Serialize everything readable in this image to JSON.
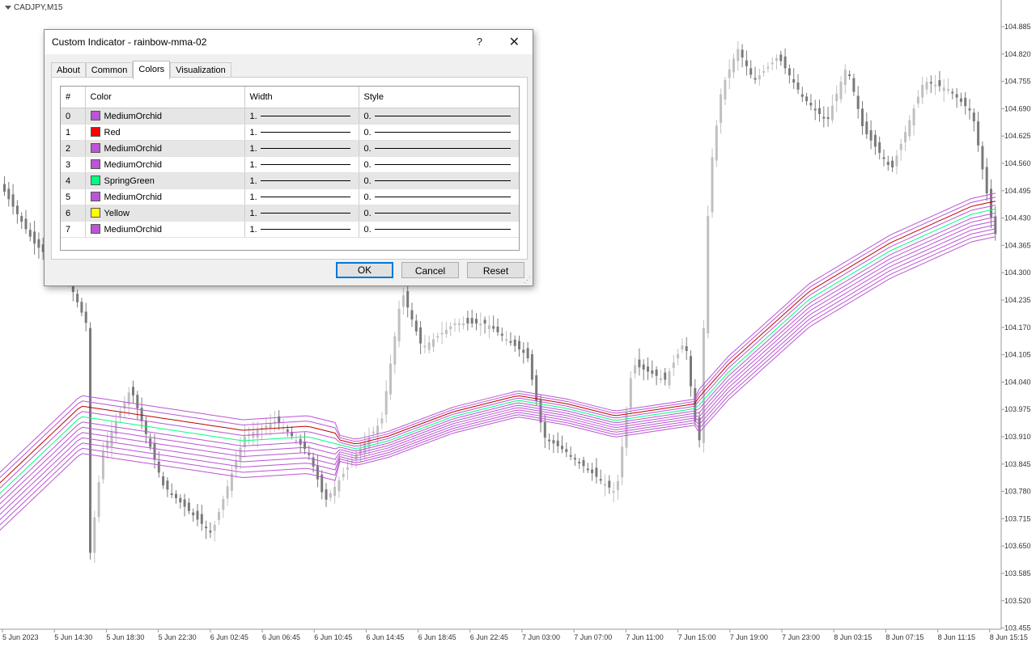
{
  "chart": {
    "symbol": "CADJPY,M15",
    "price_labels": [
      "104.885",
      "104.820",
      "104.755",
      "104.690",
      "104.625",
      "104.560",
      "104.495",
      "104.430",
      "104.365",
      "104.300",
      "104.235",
      "104.170",
      "104.105",
      "104.040",
      "103.975",
      "103.910",
      "103.845",
      "103.780",
      "103.715",
      "103.650",
      "103.585",
      "103.520",
      "103.455"
    ],
    "time_labels": [
      "5 Jun 2023",
      "5 Jun 14:30",
      "5 Jun 18:30",
      "5 Jun 22:30",
      "6 Jun 02:45",
      "6 Jun 06:45",
      "6 Jun 10:45",
      "6 Jun 14:45",
      "6 Jun 18:45",
      "6 Jun 22:45",
      "7 Jun 03:00",
      "7 Jun 07:00",
      "7 Jun 11:00",
      "7 Jun 15:00",
      "7 Jun 19:00",
      "7 Jun 23:00",
      "8 Jun 03:15",
      "8 Jun 07:15",
      "8 Jun 11:15",
      "8 Jun 15:15"
    ],
    "colors": {
      "bull": "#c0c0c0",
      "bear": "#7a7a7a",
      "orchid": "#ba55d3",
      "red": "#c00000",
      "green": "#00ff7f",
      "yellow": "#ffff00"
    }
  },
  "dialog": {
    "title": "Custom Indicator - rainbow-mma-02",
    "help": "?",
    "close": "✕",
    "tabs": [
      "About",
      "Common",
      "Colors",
      "Visualization"
    ],
    "active_tab": "Colors",
    "columns": [
      "#",
      "Color",
      "Width",
      "Style"
    ],
    "rows": [
      {
        "index": "0",
        "color_name": "MediumOrchid",
        "color": "#ba55d3",
        "width": "1.",
        "style": "0."
      },
      {
        "index": "1",
        "color_name": "Red",
        "color": "#ff0000",
        "width": "1.",
        "style": "0."
      },
      {
        "index": "2",
        "color_name": "MediumOrchid",
        "color": "#ba55d3",
        "width": "1.",
        "style": "0."
      },
      {
        "index": "3",
        "color_name": "MediumOrchid",
        "color": "#ba55d3",
        "width": "1.",
        "style": "0."
      },
      {
        "index": "4",
        "color_name": "SpringGreen",
        "color": "#00ff7f",
        "width": "1.",
        "style": "0."
      },
      {
        "index": "5",
        "color_name": "MediumOrchid",
        "color": "#ba55d3",
        "width": "1.",
        "style": "0."
      },
      {
        "index": "6",
        "color_name": "Yellow",
        "color": "#ffff00",
        "width": "1.",
        "style": "0."
      },
      {
        "index": "7",
        "color_name": "MediumOrchid",
        "color": "#ba55d3",
        "width": "1.",
        "style": "0."
      }
    ],
    "buttons": {
      "ok": "OK",
      "cancel": "Cancel",
      "reset": "Reset"
    }
  }
}
